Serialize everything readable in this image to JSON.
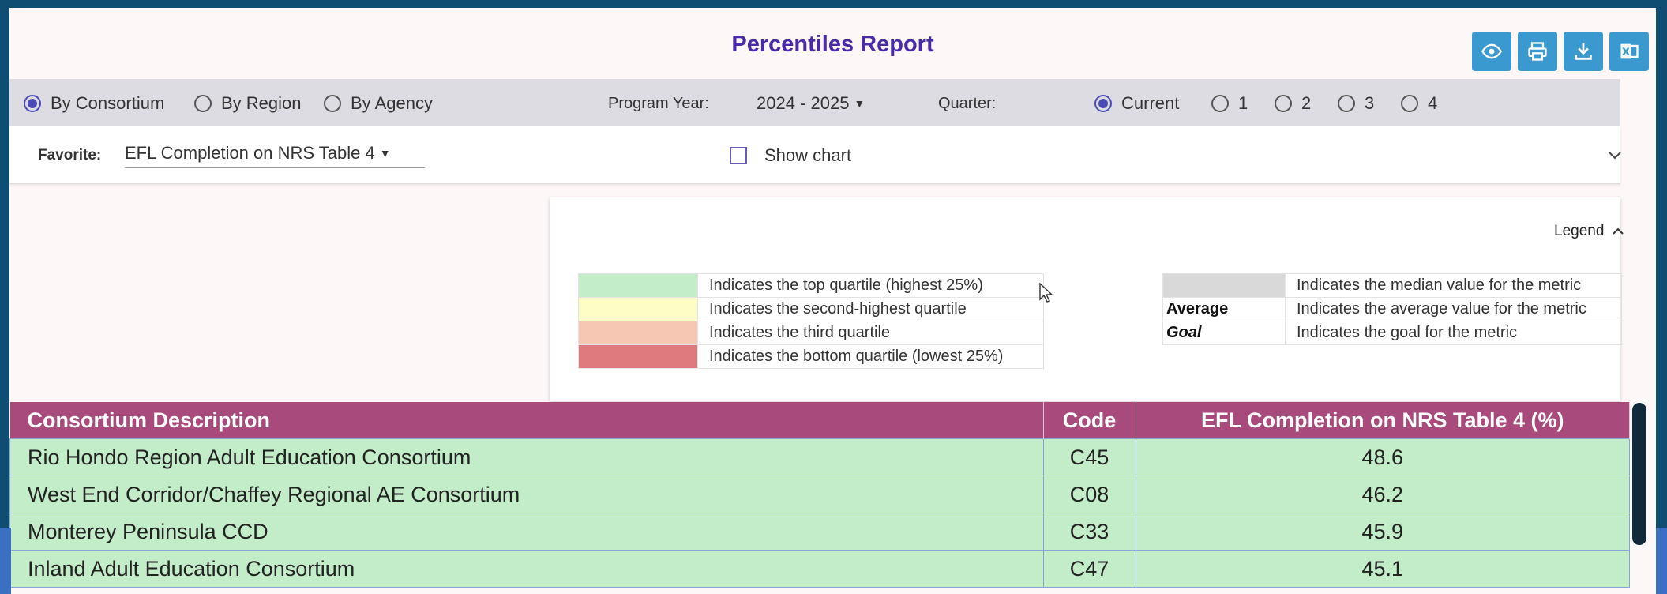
{
  "header": {
    "title": "Percentiles Report",
    "tools": [
      {
        "icon": "eye-icon"
      },
      {
        "icon": "print-icon"
      },
      {
        "icon": "download-icon"
      },
      {
        "icon": "excel-icon"
      }
    ]
  },
  "filters": {
    "scope_options": [
      {
        "label": "By Consortium",
        "selected": true
      },
      {
        "label": "By Region",
        "selected": false
      },
      {
        "label": "By Agency",
        "selected": false
      }
    ],
    "program_year_label": "Program Year:",
    "program_year_value": "2024 - 2025",
    "quarter_label": "Quarter:",
    "quarter_options": [
      {
        "label": "Current",
        "selected": true
      },
      {
        "label": "1",
        "selected": false
      },
      {
        "label": "2",
        "selected": false
      },
      {
        "label": "3",
        "selected": false
      },
      {
        "label": "4",
        "selected": false
      }
    ]
  },
  "favorite": {
    "label": "Favorite:",
    "value": "EFL Completion on NRS Table 4",
    "show_chart_label": "Show chart",
    "show_chart_checked": false
  },
  "legend": {
    "toggle_label": "Legend",
    "quartiles": [
      {
        "color": "#c3ecc8",
        "text": "Indicates the top quartile (highest 25%)"
      },
      {
        "color": "#fdfdc6",
        "text": "Indicates the second-highest quartile"
      },
      {
        "color": "#f6c8b3",
        "text": "Indicates the third quartile"
      },
      {
        "color": "#df7b7e",
        "text": "Indicates the bottom quartile (lowest 25%)"
      }
    ],
    "markers": [
      {
        "key": "",
        "style": "median",
        "color": "#d9d9d9",
        "text": "Indicates the median value for the metric"
      },
      {
        "key": "Average",
        "style": "bold",
        "text": "Indicates the average value for the metric"
      },
      {
        "key": "Goal",
        "style": "bold-italic",
        "text": "Indicates the goal for the metric"
      }
    ]
  },
  "table": {
    "headers": [
      "Consortium Description",
      "Code",
      "EFL Completion on NRS Table 4 (%)"
    ],
    "rows": [
      [
        "Rio Hondo Region Adult Education Consortium",
        "C45",
        "48.6"
      ],
      [
        "West End Corridor/Chaffey Regional AE Consortium",
        "C08",
        "46.2"
      ],
      [
        "Monterey Peninsula CCD",
        "C33",
        "45.9"
      ],
      [
        "Inland Adult Education Consortium",
        "C47",
        "45.1"
      ]
    ]
  },
  "colors": {
    "title": "#4b2aa8",
    "tool_button": "#3a9ad0",
    "table_header": "#a84a7c",
    "row_top_quartile": "#c3ecc8"
  }
}
